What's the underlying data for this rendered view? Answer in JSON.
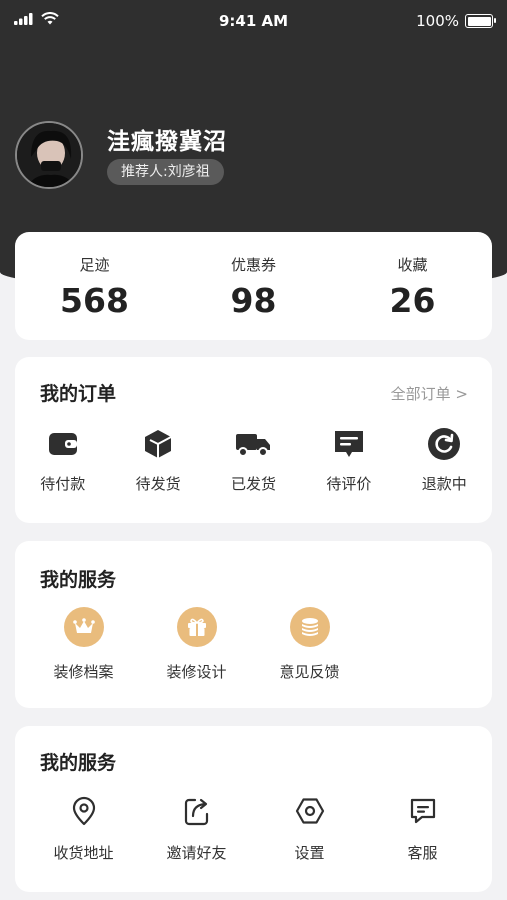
{
  "status_bar": {
    "time": "9:41 AM",
    "battery": "100%"
  },
  "profile": {
    "username": "洼瘋撥冀沼",
    "referrer": "推荐人:刘彦祖"
  },
  "stats": [
    {
      "label": "足迹",
      "value": "568"
    },
    {
      "label": "优惠券",
      "value": "98"
    },
    {
      "label": "收藏",
      "value": "26"
    }
  ],
  "orders": {
    "title": "我的订单",
    "all_link": "全部订单 >",
    "items": [
      {
        "label": "待付款",
        "icon": "wallet-icon"
      },
      {
        "label": "待发货",
        "icon": "package-icon"
      },
      {
        "label": "已发货",
        "icon": "truck-icon"
      },
      {
        "label": "待评价",
        "icon": "review-icon"
      },
      {
        "label": "退款中",
        "icon": "refund-icon"
      }
    ]
  },
  "services": {
    "title": "我的服务",
    "items": [
      {
        "label": "装修档案",
        "icon": "crown-icon"
      },
      {
        "label": "装修设计",
        "icon": "gift-icon"
      },
      {
        "label": "意见反馈",
        "icon": "coins-icon"
      }
    ]
  },
  "tools": {
    "title": "我的服务",
    "items": [
      {
        "label": "收货地址",
        "icon": "location-icon"
      },
      {
        "label": "邀请好友",
        "icon": "share-icon"
      },
      {
        "label": "设置",
        "icon": "settings-icon"
      },
      {
        "label": "客服",
        "icon": "chat-icon"
      }
    ]
  },
  "colors": {
    "header": "#2f2f2f",
    "accent": "#e9bc7d",
    "background": "#f2f2f4"
  }
}
